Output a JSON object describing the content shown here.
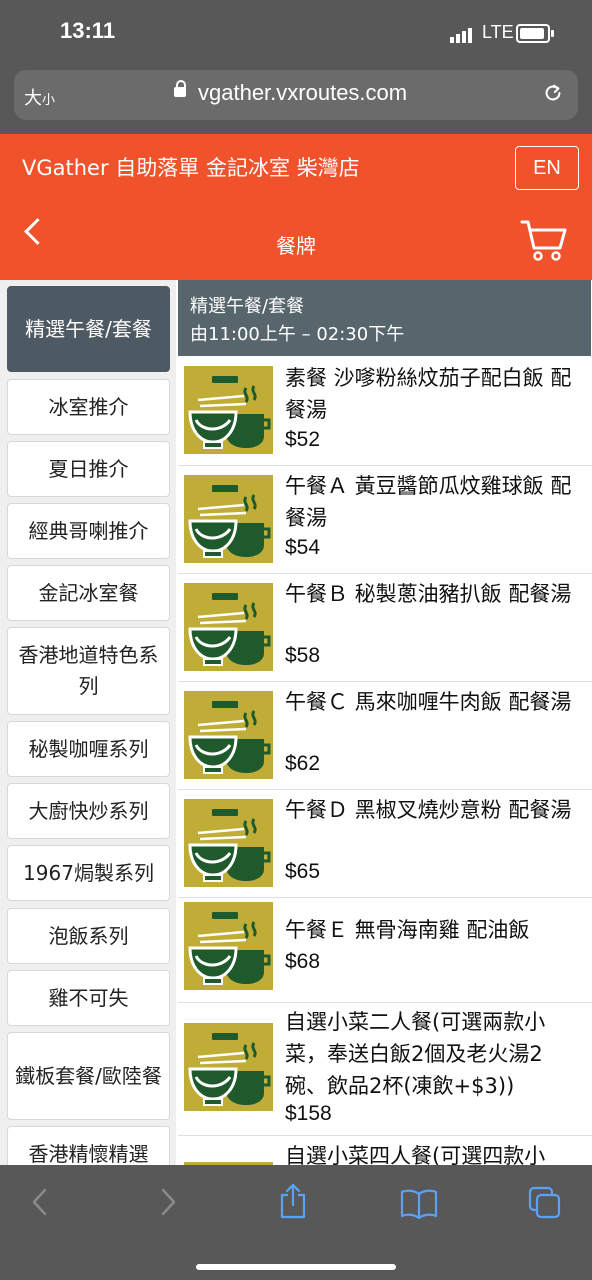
{
  "status": {
    "time": "13:11",
    "network": "LTE"
  },
  "browser": {
    "text_size": "大",
    "text_size_small": "小",
    "url": "vgather.vxroutes.com"
  },
  "header": {
    "store_name": "VGather 自助落單 金記冰室 柴灣店",
    "lang_button": "EN",
    "page_title": "餐牌"
  },
  "sidebar": {
    "categories": [
      "精選午餐/套餐",
      "冰室推介",
      "夏日推介",
      "經典哥喇推介",
      "金記冰室餐",
      "香港地道特色系列",
      "秘製咖喱系列",
      "大廚快炒系列",
      "1967焗製系列",
      "泡飯系列",
      "雞不可失",
      "鐵板套餐/歐陸餐",
      "香港精懷精選"
    ],
    "active_index": 0
  },
  "section": {
    "title": "精選午餐/套餐",
    "hours": "由11:00上午 – 02:30下午"
  },
  "items": [
    {
      "name": "素餐 沙嗲粉絲炆茄子配白飯 配餐湯",
      "price": "$52"
    },
    {
      "name": "午餐Ａ 黃豆醬節瓜炆雞球飯 配餐湯",
      "price": "$54"
    },
    {
      "name": "午餐Ｂ 秘製蔥油豬扒飯 配餐湯",
      "price": "$58"
    },
    {
      "name": "午餐Ｃ 馬來咖喱牛肉飯 配餐湯",
      "price": "$62"
    },
    {
      "name": "午餐Ｄ 黑椒叉燒炒意粉 配餐湯",
      "price": "$65"
    },
    {
      "name": "午餐Ｅ 無骨海南雞 配油飯",
      "price": "$68"
    },
    {
      "name": "自選小菜二人餐(可選兩款小菜，奉送白飯2個及老火湯2碗、飲品2杯(凍飲+$3))",
      "price": "$158"
    },
    {
      "name": "自選小菜四人餐(可選四款小",
      "price": ""
    }
  ],
  "colors": {
    "header": "#f0522c",
    "chrome": "#585858",
    "section": "#57666c",
    "active_category": "#4e5a63",
    "thumb_bg": "#c0ad37",
    "thumb_green": "#1f5a2c"
  }
}
